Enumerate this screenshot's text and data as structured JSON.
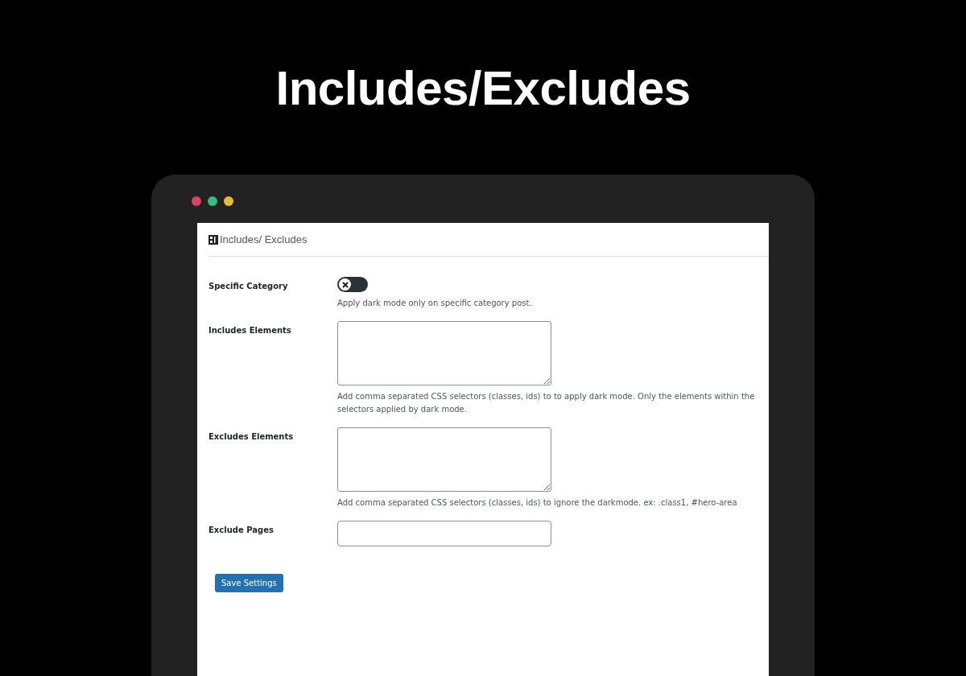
{
  "headline": "Includes/Excludes",
  "window": {
    "title": "Includes/ Excludes"
  },
  "fields": [
    {
      "kind": "toggle",
      "label": "Specific Category",
      "on": false,
      "help": "Apply dark mode only on specific category post."
    },
    {
      "kind": "textarea",
      "label": "Includes Elements",
      "help": "Add comma separated CSS selectors (classes, ids) to to apply dark mode. Only the elements within the selectors applied by dark mode."
    },
    {
      "kind": "textarea",
      "label": "Excludes Elements",
      "help": "Add comma separated CSS selectors (classes, ids) to ignore the darkmode. ex: .class1, #hero-area"
    },
    {
      "kind": "input",
      "label": "Exclude Pages"
    }
  ],
  "buttons": [
    "Save Settings"
  ]
}
